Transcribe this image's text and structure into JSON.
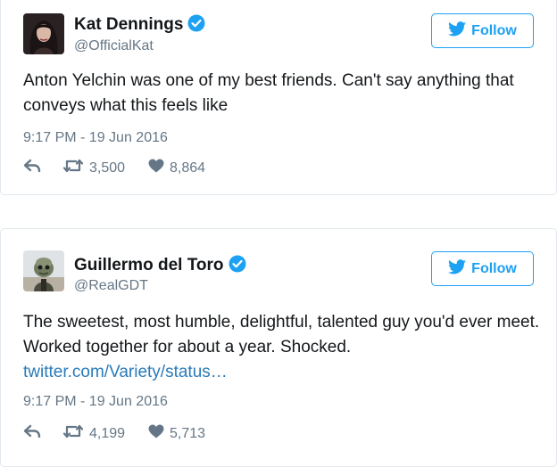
{
  "tweets": [
    {
      "display_name": "Kat Dennings",
      "handle": "@OfficialKat",
      "verified": true,
      "follow_label": "Follow",
      "text": "Anton Yelchin was one of my best friends. Can't say anything that conveys what this feels like",
      "link": "",
      "timestamp": "9:17 PM - 19 Jun 2016",
      "retweets": "3,500",
      "likes": "8,864",
      "avatar_icon": "avatar-photo-icon"
    },
    {
      "display_name": "Guillermo del Toro",
      "handle": "@RealGDT",
      "verified": true,
      "follow_label": "Follow",
      "text": "The sweetest, most humble, delightful, talented guy you'd ever meet. Worked together for about a year. Shocked.",
      "link": "twitter.com/Variety/status…",
      "timestamp": "9:17 PM - 19 Jun 2016",
      "retweets": "4,199",
      "likes": "5,713",
      "avatar_icon": "avatar-figure-icon"
    }
  ],
  "colors": {
    "accent": "#1da1f2",
    "link": "#2b7bb9",
    "muted": "#657786",
    "text": "#14171a",
    "border": "#e1e8ed"
  }
}
